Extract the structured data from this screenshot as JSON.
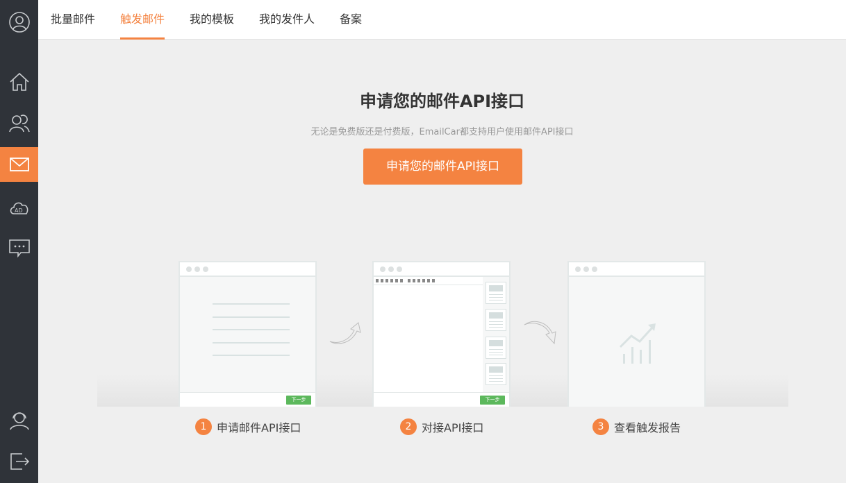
{
  "sidebar": {
    "items": [
      {
        "icon": "user-profile-icon"
      },
      {
        "icon": "home-icon"
      },
      {
        "icon": "contacts-icon"
      },
      {
        "icon": "mail-icon",
        "active": true
      },
      {
        "icon": "ad-cloud-icon"
      },
      {
        "icon": "message-icon"
      },
      {
        "icon": "support-agent-icon"
      },
      {
        "icon": "logout-icon"
      }
    ],
    "accent": "#f48341",
    "background": "#2f3339"
  },
  "tabs": [
    {
      "label": "批量邮件"
    },
    {
      "label": "触发邮件",
      "active": true
    },
    {
      "label": "我的模板"
    },
    {
      "label": "我的发件人"
    },
    {
      "label": "备案"
    }
  ],
  "main": {
    "title": "申请您的邮件API接口",
    "subtitle": "无论是免费版还是付费版，EmailCar都支持用户使用邮件API接口",
    "cta_label": "申请您的邮件API接口"
  },
  "illustration": {
    "next_label": "下一步"
  },
  "steps": [
    {
      "number": "1",
      "label": "申请邮件API接口"
    },
    {
      "number": "2",
      "label": "对接API接口"
    },
    {
      "number": "3",
      "label": "查看触发报告"
    }
  ]
}
